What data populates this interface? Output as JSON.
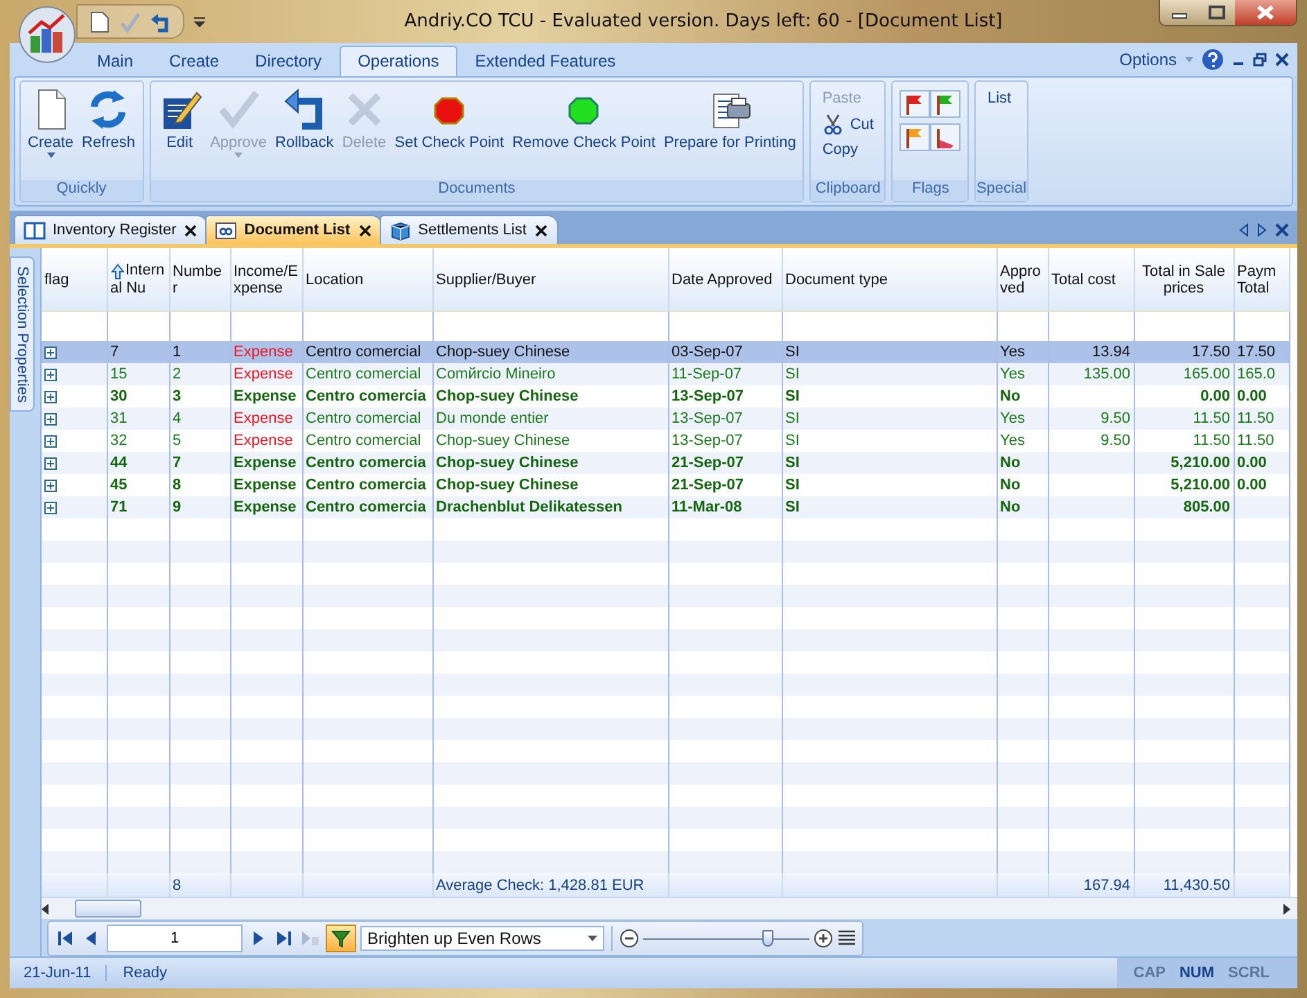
{
  "window": {
    "title": "Andriy.CO TCU - Evaluated version. Days left: 60 - [Document List]"
  },
  "ribbon_tabs": [
    {
      "label": "Main",
      "selected": false
    },
    {
      "label": "Create",
      "selected": false
    },
    {
      "label": "Directory",
      "selected": false
    },
    {
      "label": "Operations",
      "selected": true
    },
    {
      "label": "Extended Features",
      "selected": false
    }
  ],
  "options_menu": {
    "label": "Options"
  },
  "ribbon_groups": [
    {
      "title": "Quickly",
      "kind": "large",
      "buttons": [
        {
          "label": "Create",
          "disabled": false,
          "dropdown": true
        },
        {
          "label": "Refresh",
          "disabled": false,
          "dropdown": false
        }
      ]
    },
    {
      "title": "Documents",
      "kind": "large",
      "buttons": [
        {
          "label": "Edit",
          "disabled": false,
          "dropdown": false
        },
        {
          "label": "Approve",
          "disabled": true,
          "dropdown": true
        },
        {
          "label": "Rollback",
          "disabled": false,
          "dropdown": false
        },
        {
          "label": "Delete",
          "disabled": true,
          "dropdown": false
        },
        {
          "label": "Set Check Point",
          "disabled": false,
          "dropdown": false
        },
        {
          "label": "Remove Check Point",
          "disabled": false,
          "dropdown": false
        },
        {
          "label": "Prepare for Printing",
          "disabled": false,
          "dropdown": false
        }
      ]
    },
    {
      "title": "Clipboard",
      "kind": "small",
      "buttons": [
        {
          "label": "Paste",
          "disabled": true
        },
        {
          "label": "Cut",
          "disabled": false
        },
        {
          "label": "Copy",
          "disabled": false
        }
      ]
    },
    {
      "title": "Flags",
      "kind": "icons",
      "buttons": [
        {
          "disabled": false
        },
        {
          "disabled": false
        },
        {
          "disabled": false
        },
        {
          "disabled": false
        }
      ]
    },
    {
      "title": "Special",
      "kind": "small",
      "buttons": [
        {
          "label": "List",
          "disabled": false
        }
      ]
    }
  ],
  "doc_tabs": [
    {
      "label": "Inventory Register",
      "selected": false
    },
    {
      "label": "Document List",
      "selected": true
    },
    {
      "label": "Settlements List",
      "selected": false
    }
  ],
  "side_tab": {
    "label": "Selection Properties"
  },
  "grid": {
    "columns": [
      {
        "label": "flag",
        "sorted": false
      },
      {
        "label": "Internal Nu",
        "sorted": true
      },
      {
        "label": "Number",
        "sorted": false
      },
      {
        "label": "Income/Expense",
        "sorted": false
      },
      {
        "label": "Location",
        "sorted": false
      },
      {
        "label": "Supplier/Buyer",
        "sorted": false
      },
      {
        "label": "Date Approved",
        "sorted": false
      },
      {
        "label": "Document type",
        "sorted": false
      },
      {
        "label": "Approved",
        "sorted": false
      },
      {
        "label": "Total cost",
        "sorted": false
      },
      {
        "label": "Total in Sale prices",
        "sorted": false
      },
      {
        "label": "Paym Total",
        "sorted": false
      }
    ],
    "rows": [
      {
        "selected": true,
        "bold": false,
        "expanded": false,
        "cells": [
          "",
          "7",
          "1",
          "Expense",
          "Centro comercial",
          "Chop-suey Chinese",
          "03-Sep-07",
          "SI",
          "Yes",
          "13.94",
          "17.50",
          "17.50"
        ]
      },
      {
        "selected": false,
        "bold": false,
        "expanded": false,
        "cells": [
          "",
          "15",
          "2",
          "Expense",
          "Centro comercial",
          "Comйrcio Mineiro",
          "11-Sep-07",
          "SI",
          "Yes",
          "135.00",
          "165.00",
          "165.0"
        ]
      },
      {
        "selected": false,
        "bold": true,
        "expanded": false,
        "cells": [
          "",
          "30",
          "3",
          "Expense",
          "Centro comercia",
          "Chop-suey Chinese",
          "13-Sep-07",
          "SI",
          "No",
          "",
          "0.00",
          "0.00"
        ]
      },
      {
        "selected": false,
        "bold": false,
        "expanded": false,
        "cells": [
          "",
          "31",
          "4",
          "Expense",
          "Centro comercial",
          "Du monde entier",
          "13-Sep-07",
          "SI",
          "Yes",
          "9.50",
          "11.50",
          "11.50"
        ]
      },
      {
        "selected": false,
        "bold": false,
        "expanded": false,
        "cells": [
          "",
          "32",
          "5",
          "Expense",
          "Centro comercial",
          "Chop-suey Chinese",
          "13-Sep-07",
          "SI",
          "Yes",
          "9.50",
          "11.50",
          "11.50"
        ]
      },
      {
        "selected": false,
        "bold": true,
        "expanded": false,
        "cells": [
          "",
          "44",
          "7",
          "Expense",
          "Centro comercia",
          "Chop-suey Chinese",
          "21-Sep-07",
          "SI",
          "No",
          "",
          "5,210.00",
          "0.00"
        ]
      },
      {
        "selected": false,
        "bold": true,
        "expanded": false,
        "cells": [
          "",
          "45",
          "8",
          "Expense",
          "Centro comercia",
          "Chop-suey Chinese",
          "21-Sep-07",
          "SI",
          "No",
          "",
          "5,210.00",
          "0.00"
        ]
      },
      {
        "selected": false,
        "bold": true,
        "expanded": false,
        "cells": [
          "",
          "71",
          "9",
          "Expense",
          "Centro comercia",
          "Drachenblut Delikatessen",
          "11-Mar-08",
          "SI",
          "No",
          "",
          "805.00",
          ""
        ]
      }
    ],
    "footer": {
      "count": "8",
      "average": "Average Check: 1,428.81 EUR",
      "total_cost": "167.94",
      "total_sale": "11,430.50"
    }
  },
  "navigator": {
    "page": "1",
    "filter_on": true,
    "view": "Brighten up Even Rows",
    "zoom": {
      "level": 0.75
    }
  },
  "status_bar": {
    "date": "21-Jun-11",
    "message": "Ready",
    "indicators": [
      {
        "label": "CAP",
        "on": false
      },
      {
        "label": "NUM",
        "on": true
      },
      {
        "label": "SCRL",
        "on": false
      }
    ]
  }
}
